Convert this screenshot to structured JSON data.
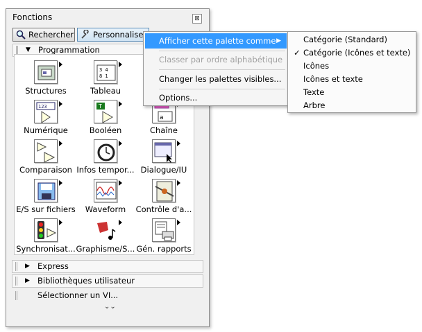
{
  "palette": {
    "title": "Fonctions",
    "close_label": "⊠",
    "search_label": "Rechercher",
    "customize_label": "Personnaliser",
    "section_programming": "Programmation",
    "items": [
      {
        "label": "Structures",
        "icon": "structures-icon"
      },
      {
        "label": "Tableau",
        "icon": "array-icon"
      },
      {
        "label": "Numérique",
        "icon": "numeric-icon"
      },
      {
        "label": "Booléen",
        "icon": "boolean-icon"
      },
      {
        "label": "Chaîne",
        "icon": "string-icon"
      },
      {
        "label": "Comparaison",
        "icon": "comparison-icon"
      },
      {
        "label": "Infos tempor...",
        "icon": "timing-icon"
      },
      {
        "label": "Dialogue/IU",
        "icon": "dialog-icon"
      },
      {
        "label": "E/S sur fichiers",
        "icon": "file-io-icon"
      },
      {
        "label": "Waveform",
        "icon": "waveform-icon"
      },
      {
        "label": "Contrôle d'a...",
        "icon": "app-control-icon"
      },
      {
        "label": "Synchronisat...",
        "icon": "synchronization-icon"
      },
      {
        "label": "Graphisme/S...",
        "icon": "graphics-sound-icon"
      },
      {
        "label": "Gén. rapports",
        "icon": "report-generation-icon"
      }
    ],
    "section_express": "Express",
    "section_user_libs": "Bibliothèques utilisateur",
    "select_vi": "Sélectionner un VI...",
    "more_label": "⌄⌄"
  },
  "context_menu": {
    "items": [
      {
        "label": "Afficher cette palette comme",
        "highlighted": true,
        "submenu": true
      },
      {
        "label": "Classer par ordre alphabétique",
        "disabled": true
      },
      {
        "label": "Changer les palettes visibles..."
      },
      {
        "label": "Options..."
      }
    ],
    "submenu_arrow": "▶"
  },
  "submenu": {
    "items": [
      {
        "label": "Catégorie (Standard)",
        "checked": false
      },
      {
        "label": "Catégorie (Icônes et texte)",
        "checked": true
      },
      {
        "label": "Icônes",
        "checked": false
      },
      {
        "label": "Icônes et texte",
        "checked": false
      },
      {
        "label": "Texte",
        "checked": false
      },
      {
        "label": "Arbre",
        "checked": false
      }
    ],
    "check_mark": "✓"
  },
  "colors": {
    "highlight": "#3399ff",
    "disabled": "#a0a0a0"
  }
}
